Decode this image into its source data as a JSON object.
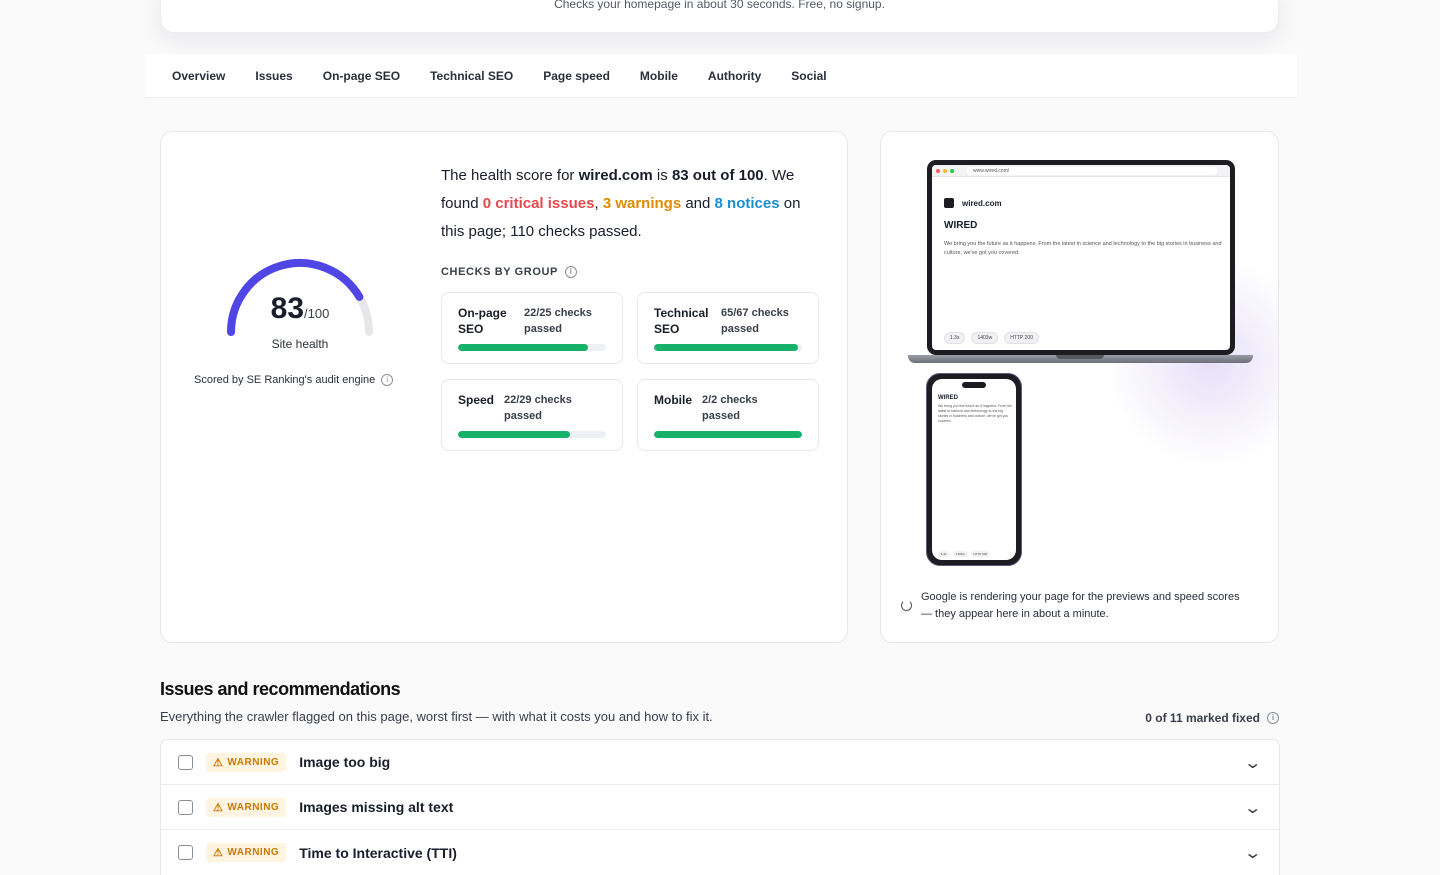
{
  "header": {
    "subtitle": "Checks your homepage in about 30 seconds. Free, no signup."
  },
  "tabs": [
    "Overview",
    "Issues",
    "On-page SEO",
    "Technical SEO",
    "Page speed",
    "Mobile",
    "Authority",
    "Social"
  ],
  "health": {
    "score": "83",
    "max": "/100",
    "label": "Site health",
    "score_fraction": 0.83,
    "scored_by": "Scored by SE Ranking's audit engine",
    "summary": {
      "prefix": "The health score for ",
      "domain": "wired.com",
      "is": " is ",
      "score_text": "83 out of 100",
      "found": ". We found ",
      "critical": "0 critical issues",
      "comma": ", ",
      "warnings": "3 warnings",
      "and": " and ",
      "notices": "8 notices",
      "suffix": " on this page; 110 checks passed."
    },
    "checks_title": "CHECKS BY GROUP",
    "groups": [
      {
        "name": "On-page SEO",
        "value": "22/25 checks passed",
        "fraction": 0.88
      },
      {
        "name": "Technical SEO",
        "value": "65/67 checks passed",
        "fraction": 0.97
      },
      {
        "name": "Speed",
        "value": "22/29 checks passed",
        "fraction": 0.76
      },
      {
        "name": "Mobile",
        "value": "2/2 checks passed",
        "fraction": 1.0
      }
    ]
  },
  "preview": {
    "url": "www.wired.com/",
    "site_name": "wired.com",
    "brand": "WIRED",
    "description": "We bring you the future as it happens. From the latest in science and technology to the big stories in business and culture, we've got you covered.",
    "chips": [
      "1.3s",
      "1403w",
      "HTTP 200"
    ],
    "render_note": "Google is rendering your page for the previews and speed scores — they appear here in about a minute."
  },
  "issues": {
    "title": "Issues and recommendations",
    "subtitle": "Everything the crawler flagged on this page, worst first — with what it costs you and how to fix it.",
    "fixed_count": "0 of 11 marked fixed",
    "rows": [
      {
        "severity": "WARNING",
        "title": "Image too big"
      },
      {
        "severity": "WARNING",
        "title": "Images missing alt text"
      },
      {
        "severity": "WARNING",
        "title": "Time to Interactive (TTI)"
      }
    ]
  },
  "colors": {
    "gauge": "#4f46e5",
    "bar": "#17b26a",
    "critical": "#e5484d",
    "warning": "#e08a00",
    "notice": "#1a8fd1"
  }
}
